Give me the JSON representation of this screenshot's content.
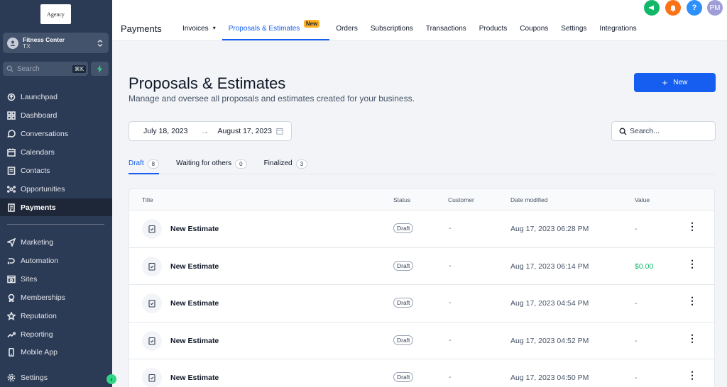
{
  "sidebar": {
    "logo": "Agency",
    "account": {
      "name": "Fitness Center",
      "sub": "TX"
    },
    "search": {
      "placeholder": "Search",
      "shortcut": "⌘K"
    },
    "items": [
      {
        "label": "Launchpad",
        "icon": "rocket-icon"
      },
      {
        "label": "Dashboard",
        "icon": "grid-icon"
      },
      {
        "label": "Conversations",
        "icon": "chat-icon"
      },
      {
        "label": "Calendars",
        "icon": "calendar-icon"
      },
      {
        "label": "Contacts",
        "icon": "contacts-icon"
      },
      {
        "label": "Opportunities",
        "icon": "opportunities-icon"
      },
      {
        "label": "Payments",
        "icon": "payments-icon"
      }
    ],
    "items2": [
      {
        "label": "Marketing",
        "icon": "send-icon"
      },
      {
        "label": "Automation",
        "icon": "automation-icon"
      },
      {
        "label": "Sites",
        "icon": "sites-icon"
      },
      {
        "label": "Memberships",
        "icon": "memberships-icon"
      },
      {
        "label": "Reputation",
        "icon": "star-icon"
      },
      {
        "label": "Reporting",
        "icon": "chart-icon"
      },
      {
        "label": "Mobile App",
        "icon": "phone-icon"
      }
    ],
    "settings": "Settings",
    "active_item": "Payments"
  },
  "topbar": {
    "section": "Payments",
    "tabs": [
      "Invoices",
      "Proposals & Estimates",
      "Orders",
      "Subscriptions",
      "Transactions",
      "Products",
      "Coupons",
      "Settings",
      "Integrations"
    ],
    "new_badge": "New",
    "active_tab": "Proposals & Estimates",
    "avatar_initials": "PM",
    "help": "?"
  },
  "page": {
    "title": "Proposals & Estimates",
    "subtitle": "Manage and oversee all proposals and estimates created for your business.",
    "new_button": "New",
    "date_from": "July 18, 2023",
    "date_to": "August 17, 2023",
    "search_placeholder": "Search..."
  },
  "filters": [
    {
      "label": "Draft",
      "count": "8"
    },
    {
      "label": "Waiting for others",
      "count": "0"
    },
    {
      "label": "Finalized",
      "count": "3"
    }
  ],
  "table": {
    "headers": [
      "Title",
      "Status",
      "Customer",
      "Date modified",
      "Value"
    ],
    "rows": [
      {
        "title": "New Estimate",
        "status": "Draft",
        "customer": "-",
        "date": "Aug 17, 2023 06:28 PM",
        "value": "-"
      },
      {
        "title": "New Estimate",
        "status": "Draft",
        "customer": "-",
        "date": "Aug 17, 2023 06:14 PM",
        "value": "$0.00"
      },
      {
        "title": "New Estimate",
        "status": "Draft",
        "customer": "-",
        "date": "Aug 17, 2023 04:54 PM",
        "value": "-"
      },
      {
        "title": "New Estimate",
        "status": "Draft",
        "customer": "-",
        "date": "Aug 17, 2023 04:52 PM",
        "value": "-"
      },
      {
        "title": "New Estimate",
        "status": "Draft",
        "customer": "-",
        "date": "Aug 17, 2023 04:50 PM",
        "value": "-"
      }
    ]
  },
  "colors": {
    "accent": "#155eef",
    "sidebar": "#2b3a55",
    "badge": "#fdb022",
    "positive": "#12b76a"
  }
}
